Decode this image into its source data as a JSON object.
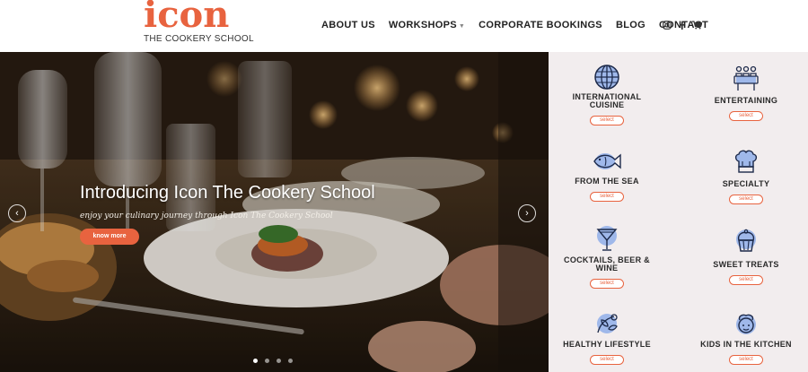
{
  "brand": {
    "word": "icon",
    "sub": "THE COOKERY SCHOOL",
    "accent": "#e8633f"
  },
  "nav": {
    "items": [
      {
        "label": "ABOUT US"
      },
      {
        "label": "WORKSHOPS",
        "has_dropdown": true
      },
      {
        "label": "CORPORATE BOOKINGS"
      },
      {
        "label": "BLOG"
      },
      {
        "label": "CONTACT"
      }
    ],
    "social": [
      "instagram-icon",
      "facebook-icon",
      "cart-icon"
    ]
  },
  "hero": {
    "title": "Introducing Icon The Cookery School",
    "subtitle": "enjoy your culinary journey through Icon The Cookery School",
    "button": "know more",
    "slides": 4,
    "active_slide": 1
  },
  "categories": [
    {
      "label": "INTERNATIONAL CUISINE",
      "icon": "globe-icon",
      "select": "select"
    },
    {
      "label": "ENTERTAINING",
      "icon": "dinner-party-icon",
      "select": "select"
    },
    {
      "label": "FROM THE SEA",
      "icon": "fish-icon",
      "select": "select"
    },
    {
      "label": "SPECIALTY",
      "icon": "chef-hat-icon",
      "select": "select"
    },
    {
      "label": "COCKTAILS, BEER & WINE",
      "icon": "cocktail-icon",
      "select": "select"
    },
    {
      "label": "SWEET TREATS",
      "icon": "cupcake-icon",
      "select": "select"
    },
    {
      "label": "HEALTHY LIFESTYLE",
      "icon": "healthy-food-icon",
      "select": "select"
    },
    {
      "label": "KIDS IN THE KITCHEN",
      "icon": "kid-chef-icon",
      "select": "select"
    }
  ]
}
